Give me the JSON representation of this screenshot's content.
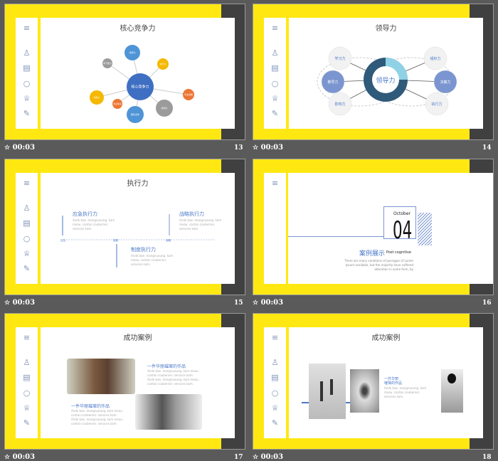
{
  "slides": [
    {
      "number": "13",
      "time": "00:03",
      "title": "核心竞争力",
      "center": "核心竞争力",
      "nodes": [
        "领导力",
        "执行力",
        "专业技能",
        "协调力",
        "团队合作",
        "专业知识",
        "创新力",
        "学习能力"
      ]
    },
    {
      "number": "14",
      "time": "00:03",
      "title": "领导力",
      "center": "领导力",
      "nodes": [
        "学习力",
        "教导力",
        "影响力",
        "组织力",
        "决策力",
        "执行力"
      ]
    },
    {
      "number": "15",
      "time": "00:03",
      "title": "执行力",
      "items": [
        "应急执行力",
        "战略执行力",
        "制度执行力"
      ],
      "axis": [
        "应急",
        "制度",
        "战略"
      ],
      "body": "Ande bae. mangnuoung. kam meau. contan couberner. senvces kam."
    },
    {
      "number": "16",
      "time": "00:03",
      "month": "October",
      "big": "04",
      "heading": "案例展示",
      "subheading": "Post cognitive",
      "body": "There are many variations of passages of Lorem Ipsum available, but the majority have suffered alteration in some form, by"
    },
    {
      "number": "17",
      "time": "00:03",
      "title": "成功案例",
      "heading": "一件华丽璀璨的作品",
      "body": "Ande bae. mangnuoung. kam meau. contan couberner. senvces kam. Ande bae. mangnuoung. kam meau. contan couberner. senvces kam."
    },
    {
      "number": "18",
      "time": "00:03",
      "title": "成功案例",
      "heading1": "一件华丽",
      "heading2": "璀璨的作品",
      "body": "Ande bae. mangnuoung. kam meau. contan couberner. senvces kam."
    }
  ],
  "icons": [
    "menu-icon",
    "user-icon",
    "document-icon",
    "lightbulb-icon",
    "trophy-icon",
    "pencil-icon"
  ],
  "colors": {
    "yellow": "#ffe812",
    "blue": "#4a78c8",
    "dark": "#404040"
  }
}
